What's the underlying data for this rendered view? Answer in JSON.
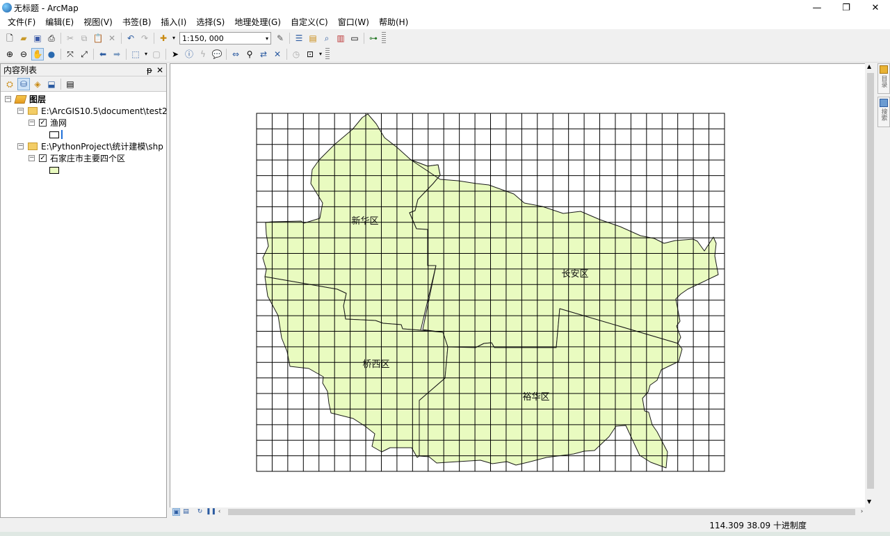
{
  "window": {
    "title": "无标题 - ArcMap",
    "controls": {
      "minimize": "—",
      "restore": "❐",
      "close": "✕"
    }
  },
  "menu": [
    "文件(F)",
    "编辑(E)",
    "视图(V)",
    "书签(B)",
    "插入(I)",
    "选择(S)",
    "地理处理(G)",
    "自定义(C)",
    "窗口(W)",
    "帮助(H)"
  ],
  "toolbar": {
    "scale_value": "1:150, 000"
  },
  "toc": {
    "title": "内容列表",
    "pin": "ᵽ",
    "close": "✕",
    "root": "图层",
    "groups": [
      {
        "path": "E:\\ArcGIS10.5\\document\\test2",
        "layer": "渔网",
        "symbol_color": "#ffffff",
        "checked": true
      },
      {
        "path": "E:\\PythonProject\\统计建模\\shp",
        "layer": "石家庄市主要四个区",
        "symbol_color": "#e9fbc0",
        "checked": true
      }
    ]
  },
  "map": {
    "fill_color": "#e9fbc0",
    "grid_cols": 30,
    "grid_rows": 23,
    "labels": [
      {
        "key": "xinhua",
        "text": "新华区"
      },
      {
        "key": "changan",
        "text": "长安区"
      },
      {
        "key": "qiaoxi",
        "text": "桥西区"
      },
      {
        "key": "yuhua",
        "text": "裕华区"
      }
    ]
  },
  "dock": [
    {
      "label": "目录"
    },
    {
      "label": "搜索"
    }
  ],
  "status": {
    "coords": "114.309  38.09 十进制度"
  }
}
